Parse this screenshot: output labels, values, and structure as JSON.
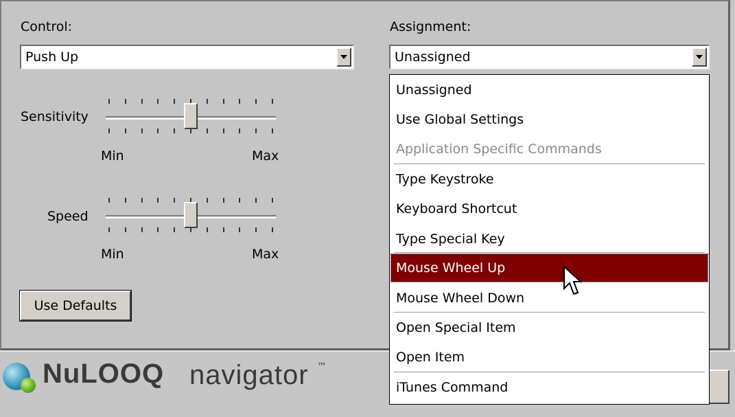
{
  "control": {
    "label": "Control:",
    "value": "Push Up"
  },
  "assignment": {
    "label": "Assignment:",
    "value": "Unassigned"
  },
  "sensitivity": {
    "label": "Sensitivity",
    "min_label": "Min",
    "max_label": "Max",
    "level_fraction": 0.5
  },
  "speed": {
    "label": "Speed",
    "min_label": "Min",
    "max_label": "Max",
    "level_fraction": 0.5
  },
  "use_defaults_label": "Use Defaults",
  "dropdown": {
    "items": [
      {
        "label": "Unassigned"
      },
      {
        "label": "Use Global Settings"
      },
      {
        "label": "Application Specific Commands"
      },
      {
        "label": "Type Keystroke"
      },
      {
        "label": "Keyboard Shortcut"
      },
      {
        "label": "Type Special Key"
      },
      {
        "label": "Mouse Wheel Up"
      },
      {
        "label": "Mouse Wheel Down"
      },
      {
        "label": "Open Special Item"
      },
      {
        "label": "Open Item"
      },
      {
        "label": "iTunes Command"
      }
    ],
    "selected": "Mouse Wheel Up",
    "disabled": "Application Specific Commands"
  },
  "logo": {
    "brand": "NuLOOQ",
    "product": "navigator",
    "tm": "™"
  },
  "colors": {
    "background": "#c6c6c6",
    "selection": "#7f0000"
  }
}
